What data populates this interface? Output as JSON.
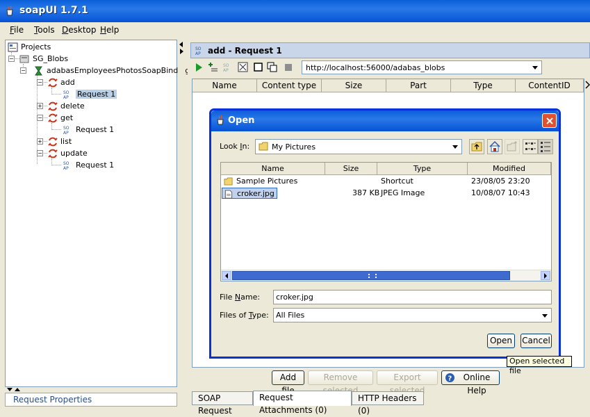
{
  "window": {
    "title": "soapUI 1.7.1"
  },
  "menu": {
    "items": [
      "File",
      "Tools",
      "Desktop",
      "Help"
    ]
  },
  "tree": {
    "root": "Projects",
    "project": "SG_Blobs",
    "interface": "adabasEmployeesPhotosSoapBinding",
    "operations": [
      {
        "name": "add",
        "request": "Request 1"
      },
      {
        "name": "delete",
        "request": ""
      },
      {
        "name": "get",
        "request": "Request 1"
      },
      {
        "name": "list",
        "request": ""
      },
      {
        "name": "update",
        "request": "Request 1"
      }
    ],
    "footer_label": "Request Properties"
  },
  "request_panel": {
    "title": "add - Request 1",
    "endpoint": "http://localhost:56000/adabas_blobs",
    "columns": [
      "Name",
      "Content type",
      "Size",
      "Part",
      "Type",
      "ContentID"
    ],
    "buttons": {
      "add_file": "Add file",
      "remove_selected": "Remove selected",
      "export_selected": "Export selected",
      "online_help": "Online Help"
    },
    "tabs": [
      "SOAP Request",
      "Request Attachments (0)",
      "HTTP Headers (0)"
    ]
  },
  "dialog": {
    "title": "Open",
    "look_in_label": "Look In:",
    "look_in_value": "My Pictures",
    "columns": [
      "Name",
      "Size",
      "Type",
      "Modified"
    ],
    "files": [
      {
        "name": "Sample Pictures",
        "size": "",
        "type": "Shortcut",
        "modified": "23/08/05 23:20"
      },
      {
        "name": "croker.jpg",
        "size": "387 KB",
        "type": "JPEG Image",
        "modified": "10/08/07 10:43"
      }
    ],
    "file_name_label": "File Name:",
    "file_name_value": "croker.jpg",
    "files_of_type_label": "Files of Type:",
    "files_of_type_value": "All Files",
    "open_button": "Open",
    "cancel_button": "Cancel",
    "tooltip": "Open selected file"
  },
  "colors": {
    "title_bar": "#0a5fd9",
    "selection": "#b8cfe5",
    "close_button": "#e0512f"
  }
}
